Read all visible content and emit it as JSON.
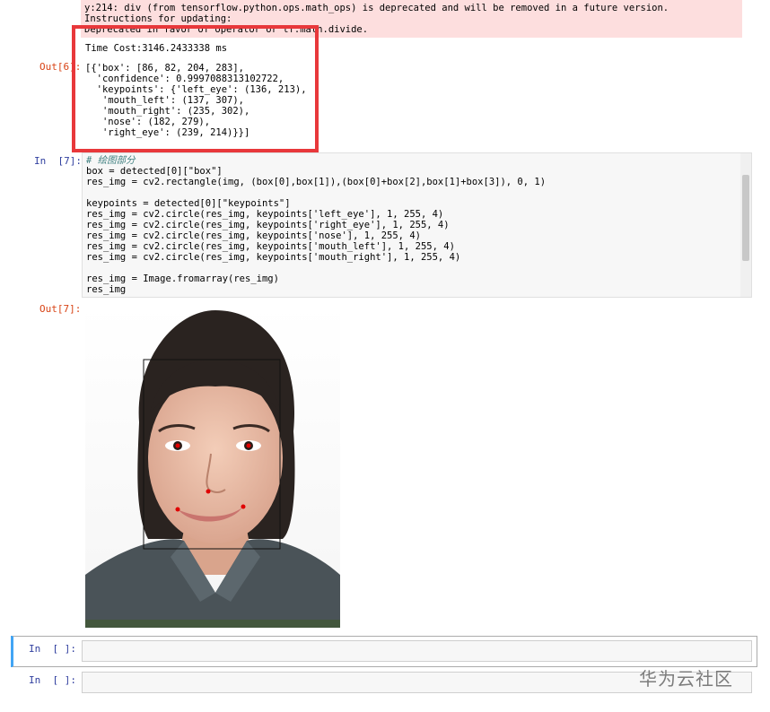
{
  "warning": {
    "line1": "y:214: div (from tensorflow.python.ops.math_ops) is deprecated and will be removed in a future version.",
    "line2": "Instructions for updating:",
    "line3": "Deprecated in favor of operator or tf.math.divide."
  },
  "cells": [
    {
      "prompt": "Out[6]:",
      "time_cost": "Time Cost:3146.2433338 ms",
      "output_lines": [
        "[{'box': [86, 82, 204, 283],",
        "  'confidence': 0.9997088313102722,",
        "  'keypoints': {'left_eye': (136, 213),",
        "   'mouth_left': (137, 307),",
        "   'mouth_right': (235, 302),",
        "   'nose': (182, 279),",
        "   'right_eye': (239, 214)}}]"
      ]
    },
    {
      "prompt": "In  [7]:",
      "code_lines": [
        "# 绘图部分",
        "box = detected[0][\"box\"]",
        "res_img = cv2.rectangle(img, (box[0],box[1]),(box[0]+box[2],box[1]+box[3]), 0, 1)",
        "",
        "keypoints = detected[0][\"keypoints\"]",
        "res_img = cv2.circle(res_img, keypoints['left_eye'], 1, 255, 4)",
        "res_img = cv2.circle(res_img, keypoints['right_eye'], 1, 255, 4)",
        "res_img = cv2.circle(res_img, keypoints['nose'], 1, 255, 4)",
        "res_img = cv2.circle(res_img, keypoints['mouth_left'], 1, 255, 4)",
        "res_img = cv2.circle(res_img, keypoints['mouth_right'], 1, 255, 4)",
        "",
        "res_img = Image.fromarray(res_img)",
        "res_img"
      ]
    },
    {
      "prompt": "Out[7]:"
    },
    {
      "prompt": "In  [ ]:"
    },
    {
      "prompt": "In  [ ]:"
    }
  ],
  "watermark": "华为云社区",
  "colors": {
    "in_prompt": "#303f9f",
    "out_prompt": "#d84315",
    "highlight_box": "#e8383b",
    "keypoint": "#e00000"
  }
}
